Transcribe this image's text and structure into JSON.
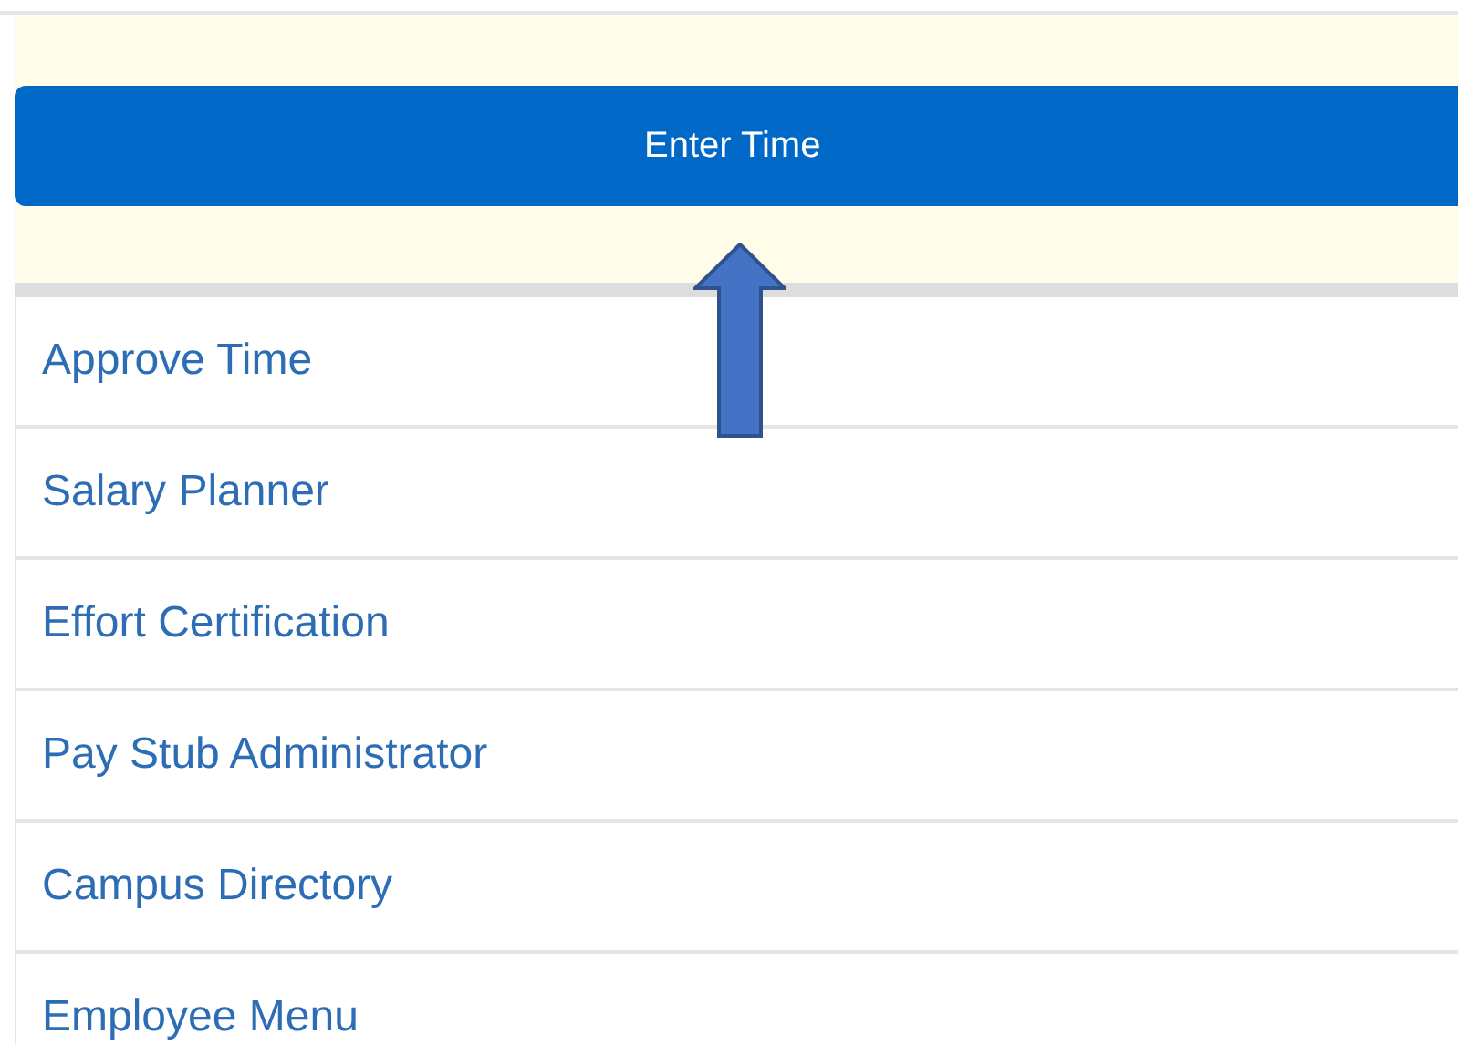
{
  "enter_button": {
    "label": "Enter Time"
  },
  "menu_items": [
    {
      "label": "Approve Time"
    },
    {
      "label": "Salary Planner"
    },
    {
      "label": "Effort Certification"
    },
    {
      "label": "Pay Stub Administrator"
    },
    {
      "label": "Campus Directory"
    },
    {
      "label": "Employee Menu"
    }
  ]
}
